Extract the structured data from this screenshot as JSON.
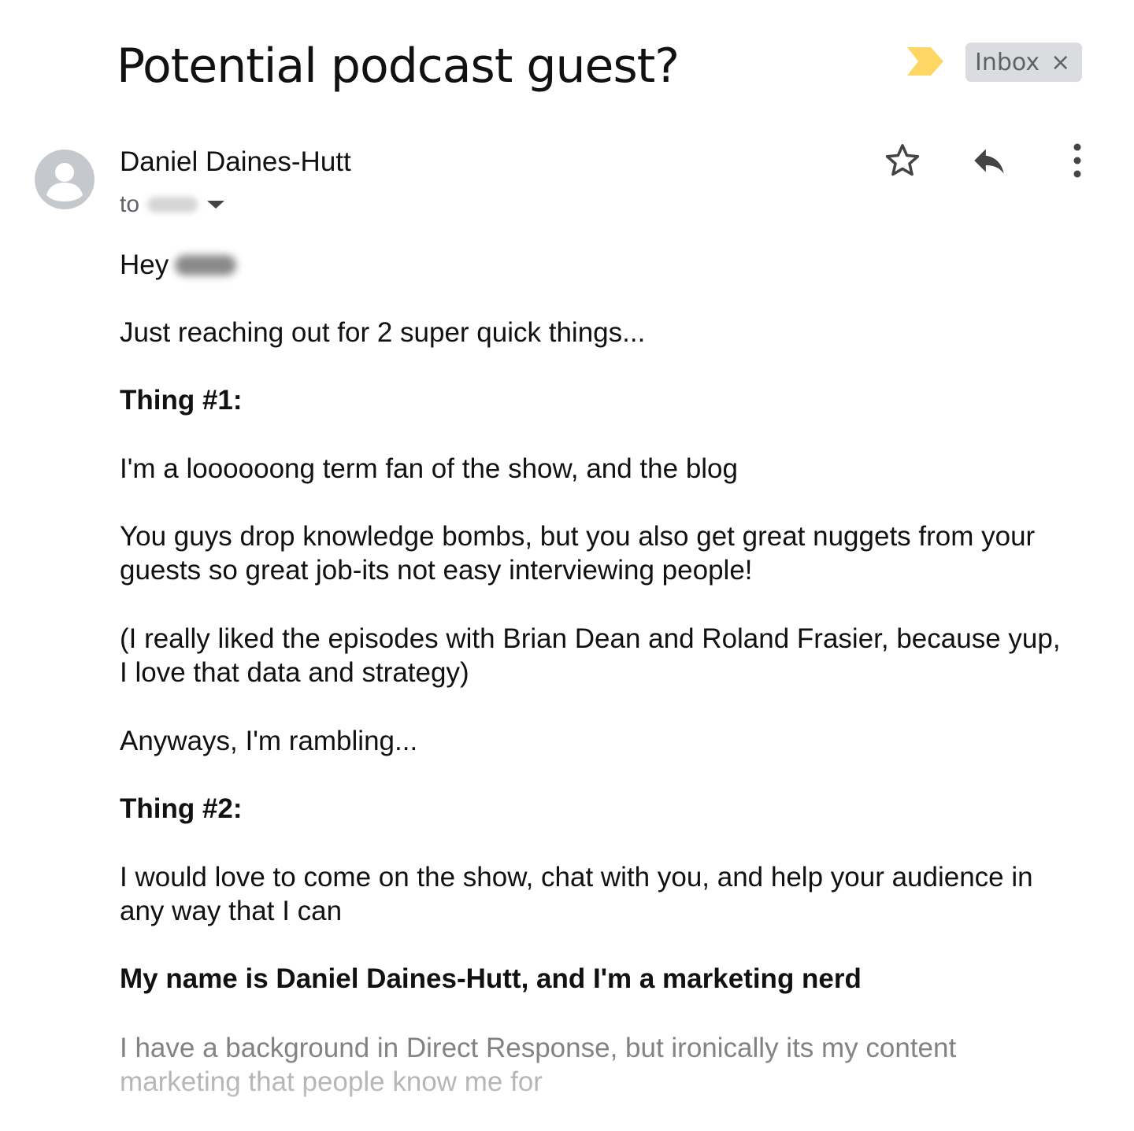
{
  "email": {
    "subject": "Potential podcast guest?",
    "label": "Inbox",
    "label_close": "×",
    "important_color": "#fdd663",
    "sender_name": "Daniel Daines-Hutt",
    "to_prefix": "to",
    "greeting": "Hey",
    "body": {
      "p1": "Just reaching out for 2 super quick things...",
      "h1": "Thing #1:",
      "p2": "I'm a loooooong term fan of the show, and the blog",
      "p3_line1": "You guys drop knowledge bombs, but you also get great nuggets from your",
      "p3_line2": "guests so great job-its not easy interviewing people!",
      "p4_line1": "(I really liked the episodes with Brian Dean and Roland Frasier, because yup,",
      "p4_line2": "I love that data and strategy)",
      "p5": "Anyways, I'm rambling...",
      "h2": "Thing #2:",
      "p6_line1": "I would love to come on the show, chat with you, and help your audience in",
      "p6_line2": "any way that I can",
      "h3": "My name is Daniel Daines-Hutt, and I'm a marketing nerd",
      "p7_line1": "I have a background in Direct Response, but ironically its my content",
      "p7_line2": "marketing that people know me for"
    },
    "icons": {
      "important": "label-important-icon",
      "avatar": "account-avatar-icon",
      "star": "star-outline-icon",
      "reply": "reply-icon",
      "more": "more-vertical-icon",
      "dropdown": "dropdown-caret-icon"
    }
  }
}
